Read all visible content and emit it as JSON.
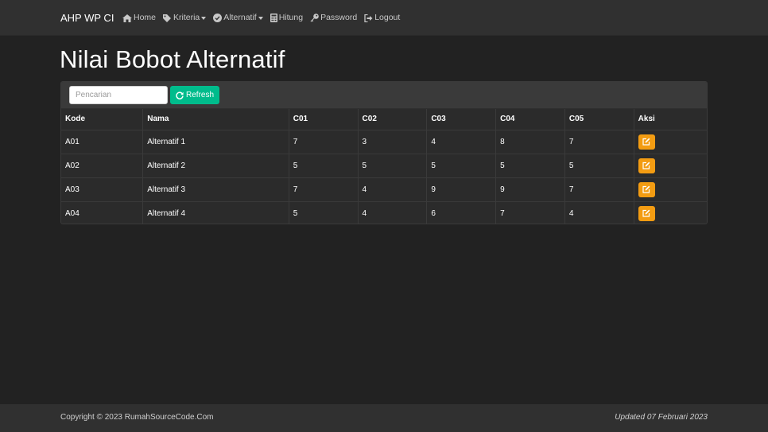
{
  "navbar": {
    "brand": "AHP WP CI",
    "items": [
      {
        "label": "Home",
        "icon": "home-icon",
        "dropdown": false
      },
      {
        "label": "Kriteria",
        "icon": "tags-icon",
        "dropdown": true
      },
      {
        "label": "Alternatif",
        "icon": "check-circle-icon",
        "dropdown": true
      },
      {
        "label": "Hitung",
        "icon": "calculator-icon",
        "dropdown": false
      },
      {
        "label": "Password",
        "icon": "key-icon",
        "dropdown": false
      },
      {
        "label": "Logout",
        "icon": "logout-icon",
        "dropdown": false
      }
    ]
  },
  "page": {
    "title": "Nilai Bobot Alternatif"
  },
  "toolbar": {
    "search_placeholder": "Pencarian",
    "search_value": "",
    "refresh_label": "Refresh"
  },
  "table": {
    "headers": [
      "Kode",
      "Nama",
      "C01",
      "C02",
      "C03",
      "C04",
      "C05",
      "Aksi"
    ],
    "rows": [
      [
        "A01",
        "Alternatif 1",
        "7",
        "3",
        "4",
        "8",
        "7"
      ],
      [
        "A02",
        "Alternatif 2",
        "5",
        "5",
        "5",
        "5",
        "5"
      ],
      [
        "A03",
        "Alternatif 3",
        "7",
        "4",
        "9",
        "9",
        "7"
      ],
      [
        "A04",
        "Alternatif 4",
        "5",
        "4",
        "6",
        "7",
        "4"
      ]
    ]
  },
  "footer": {
    "copyright": "Copyright © 2023 RumahSourceCode.Com",
    "updated": "Updated 07 Februari 2023"
  },
  "colors": {
    "background": "#222222",
    "navbar": "#303030",
    "success": "#00bc8c",
    "warning": "#f39c12"
  }
}
